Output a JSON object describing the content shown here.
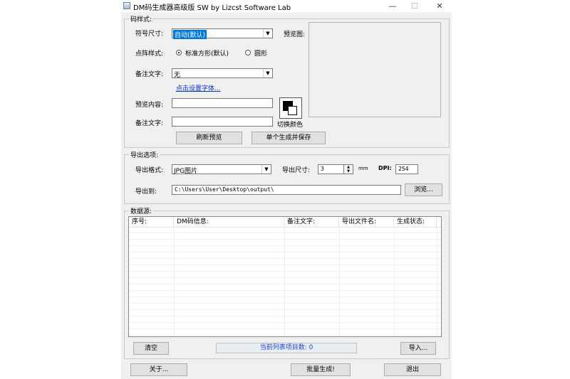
{
  "window": {
    "title": "DM码生成器高级版 SW  by Lizcst Software Lab",
    "min_glyph": "—",
    "max_glyph": "☐",
    "close_glyph": "✕"
  },
  "code_style": {
    "group_title": "码样式:",
    "symbol_size_label": "符号尺寸:",
    "symbol_size_value": "自动(默认)",
    "dot_style_label": "点阵样式:",
    "dot_style_option_square": "标准方形(默认)",
    "dot_style_option_round": "圆形",
    "note_text_label": "备注文字:",
    "note_text_value": "无",
    "set_font_link": "点击设置字体...",
    "preview_content_label": "预览内容:",
    "preview_content_value": "",
    "note_text2_label": "备注文字:",
    "note_text2_value": "",
    "preview_label": "预览图:",
    "switch_color_label": "切换颜色",
    "refresh_button": "刷新预览",
    "single_generate_button": "单个生成并保存"
  },
  "export_options": {
    "group_title": "导出选项:",
    "format_label": "导出格式:",
    "format_value": "JPG图片",
    "size_label": "导出尺寸:",
    "size_value": "3",
    "size_unit": "mm",
    "dpi_label": "DPI:",
    "dpi_value": "254",
    "export_to_label": "导出到:",
    "export_path": "C:\\Users\\User\\Desktop\\output\\",
    "browse_button": "浏览..."
  },
  "data_source": {
    "group_title": "数据源:",
    "columns": [
      "序号:",
      "DM码信息:",
      "备注文字:",
      "导出文件名:",
      "生成状态:"
    ],
    "clear_button": "清空",
    "status_text": "当前列表项目数: 0",
    "import_button": "导入..."
  },
  "footer": {
    "about_button": "关于...",
    "batch_button": "批量生成!",
    "exit_button": "退出"
  }
}
